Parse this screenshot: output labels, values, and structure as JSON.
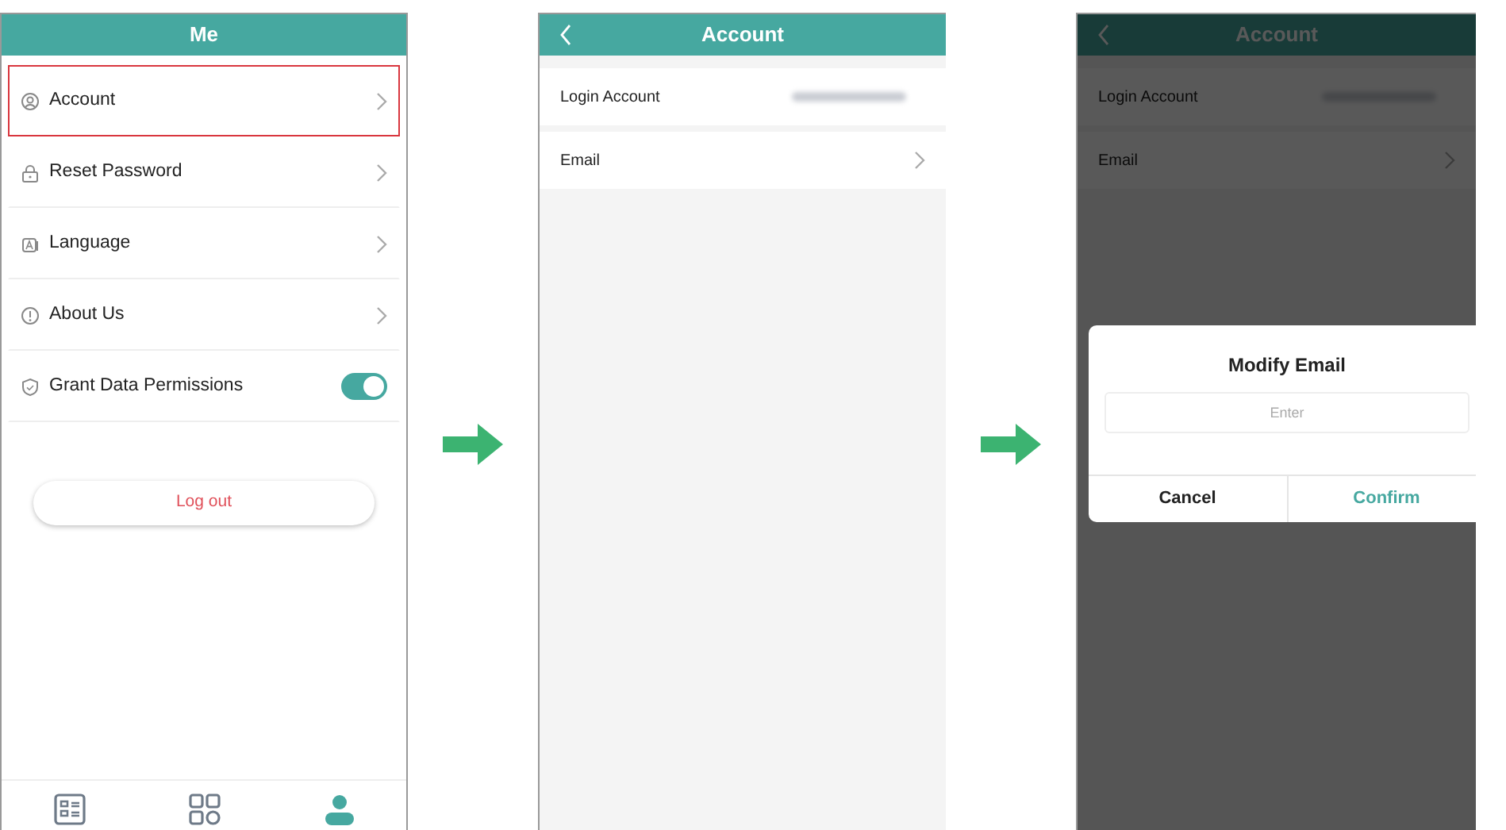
{
  "screens": [
    {
      "kind": "menu",
      "title": "Me",
      "items": [
        {
          "kind": "link",
          "label": "Account",
          "highlighted": true
        },
        {
          "kind": "link",
          "label": "Reset Password",
          "highlighted": false
        },
        {
          "kind": "link",
          "label": "Language",
          "highlighted": false
        },
        {
          "kind": "link",
          "label": "About Us",
          "highlighted": false
        },
        {
          "kind": "toggle",
          "label": "Grant Data Permissions",
          "highlighted": false,
          "on": true
        }
      ],
      "logout": "Log out",
      "tabs": [
        {
          "selected": false
        },
        {
          "selected": false
        },
        {
          "selected": true
        }
      ]
    },
    {
      "kind": "detail",
      "title": "Account",
      "dimmed": false,
      "rows": [
        {
          "kind": "value",
          "label": "Login Account"
        },
        {
          "kind": "link",
          "label": "Email"
        }
      ]
    },
    {
      "kind": "detail",
      "title": "Account",
      "dimmed": true,
      "rows": [
        {
          "kind": "value",
          "label": "Login Account"
        },
        {
          "kind": "link",
          "label": "Email"
        }
      ],
      "dialog": {
        "title": "Modify Email",
        "placeholder": "Enter",
        "buttons": [
          {
            "label": "Cancel",
            "primary": false
          },
          {
            "label": "Confirm",
            "primary": true
          }
        ]
      }
    }
  ]
}
